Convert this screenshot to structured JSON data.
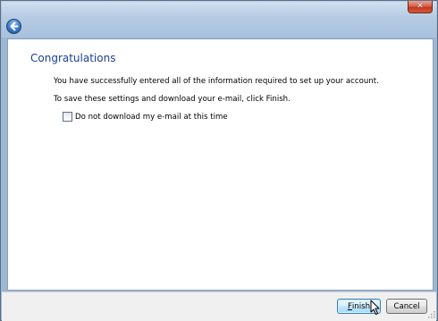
{
  "title_bar": {
    "close_glyph": "✕"
  },
  "page": {
    "title": "Congratulations",
    "line1": "You have successfully entered all of the information required to set up your account.",
    "line2": "To save these settings and download your e-mail, click Finish.",
    "checkbox": {
      "label": "Do not download my e-mail at this time",
      "checked": false
    }
  },
  "buttons": {
    "finish": {
      "access_key": "F",
      "rest": "inish"
    },
    "cancel": "Cancel"
  },
  "colors": {
    "title": "#1c3f94",
    "finish_border": "#3c7fb1"
  }
}
